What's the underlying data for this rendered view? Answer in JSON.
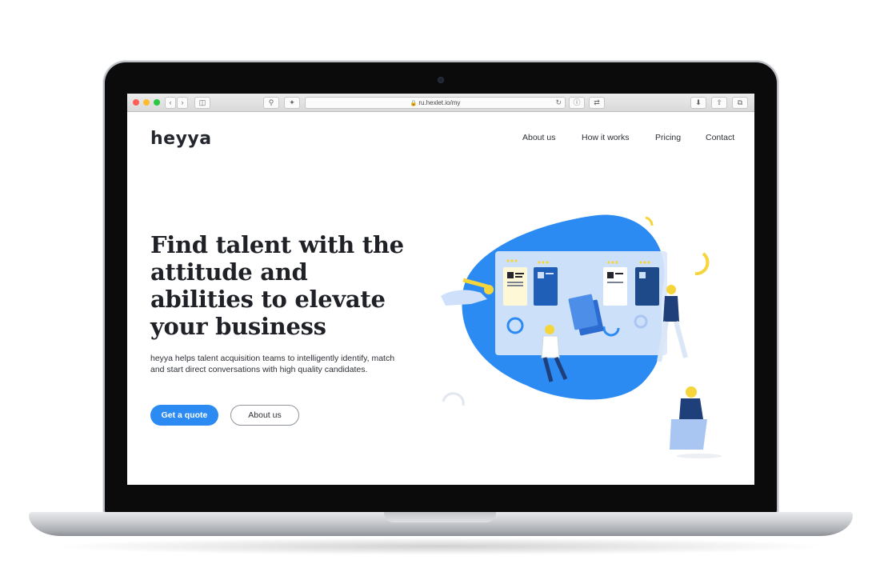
{
  "browser": {
    "url": "ru.hexlet.io/my"
  },
  "site": {
    "logo": "heyya",
    "nav": [
      "About us",
      "How it works",
      "Pricing",
      "Contact"
    ]
  },
  "hero": {
    "headline": "Find talent with the attitude and abilities to elevate your business",
    "description": "heyya helps talent acquisition teams to intelligently identify, match and start direct conversations with high quality candidates.",
    "primary_button": "Get a quote",
    "secondary_button": "About us"
  },
  "colors": {
    "accent": "#2c8bf2",
    "text": "#1f2126",
    "illustration_yellow": "#f5d53a"
  },
  "icons": [
    "back-icon",
    "forward-icon",
    "sidebar-icon",
    "shield-icon",
    "extension-icon",
    "lock-icon",
    "reload-icon",
    "password-icon",
    "translate-icon",
    "download-icon",
    "share-icon",
    "tabs-icon"
  ]
}
